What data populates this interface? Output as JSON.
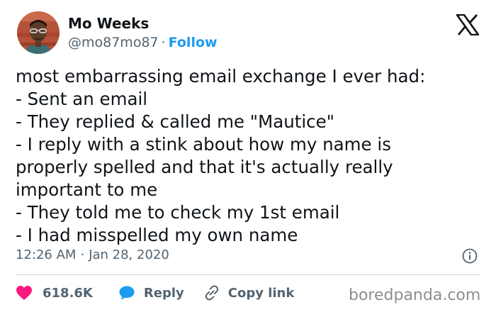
{
  "author": {
    "name": "Mo Weeks",
    "handle": "@mo87mo87",
    "separator": "·",
    "follow_label": "Follow"
  },
  "platform_icon": "x-logo-icon",
  "tweet": {
    "lines": [
      "most embarrassing email exchange I ever had:",
      "- Sent an email",
      "- They replied & called me \"Mautice\"",
      "- I reply with a stink about how my name is",
      "properly spelled and that it's actually really",
      "important to me",
      "- They told me to check my 1st email",
      "- I had misspelled my own name"
    ]
  },
  "meta": {
    "time": "12:26 AM",
    "separator": "·",
    "date": "Jan 28, 2020",
    "info_icon": "info-icon"
  },
  "actions": {
    "like": {
      "icon": "heart-icon",
      "count": "618.6K"
    },
    "reply": {
      "icon": "speech-bubble-icon",
      "label": "Reply"
    },
    "copy": {
      "icon": "link-icon",
      "label": "Copy link"
    }
  },
  "watermark": "boredpanda.com",
  "colors": {
    "text": "#0f1419",
    "secondary": "#536471",
    "link": "#1d9bf0",
    "heart": "#f91880",
    "divider": "#cfd9de"
  }
}
